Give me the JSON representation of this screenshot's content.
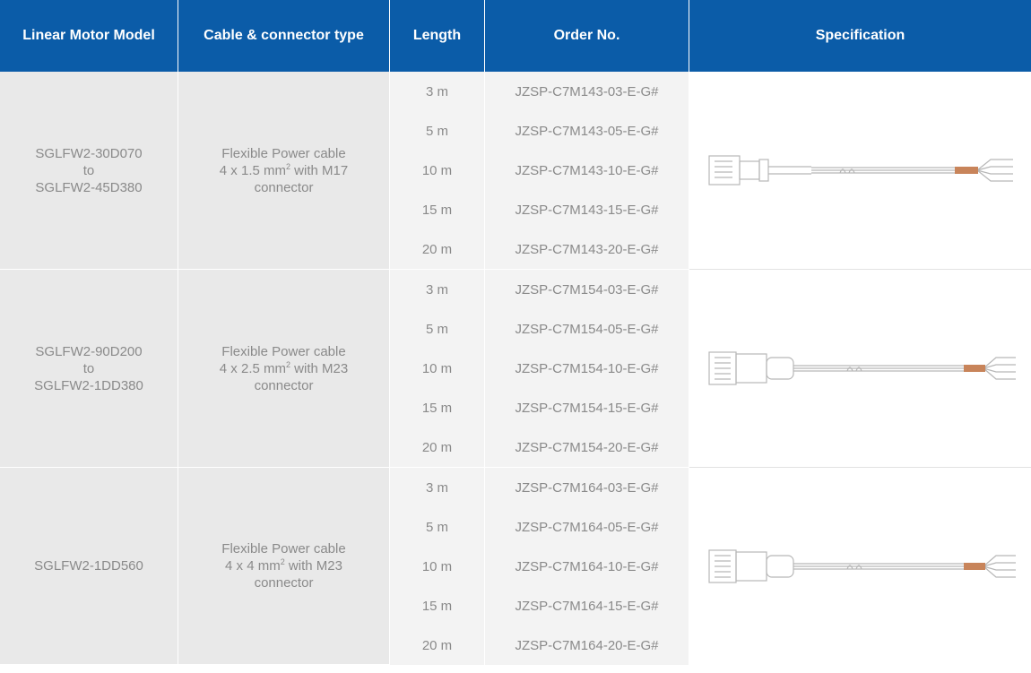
{
  "header": {
    "model": "Linear Motor Model",
    "cable_type": "Cable & connector type",
    "length": "Length",
    "order_no": "Order No.",
    "specification": "Specification"
  },
  "groups": [
    {
      "model_from": "SGLFW2-30D070",
      "model_to_word": "to",
      "model_to": "SGLFW2-45D380",
      "cable_line1": "Flexible Power cable",
      "cable_line2_prefix": "4 x 1.5 mm",
      "cable_line2_sup": "2",
      "cable_line2_suffix": " with M17",
      "cable_line3": "connector",
      "image_icon": "m17-cable-connector-image",
      "rows": [
        {
          "length": "3 m",
          "order": "JZSP-C7M143-03-E-G#"
        },
        {
          "length": "5 m",
          "order": "JZSP-C7M143-05-E-G#"
        },
        {
          "length": "10 m",
          "order": "JZSP-C7M143-10-E-G#"
        },
        {
          "length": "15 m",
          "order": "JZSP-C7M143-15-E-G#"
        },
        {
          "length": "20 m",
          "order": "JZSP-C7M143-20-E-G#"
        }
      ]
    },
    {
      "model_from": "SGLFW2-90D200",
      "model_to_word": "to",
      "model_to": "SGLFW2-1DD380",
      "cable_line1": "Flexible Power cable",
      "cable_line2_prefix": "4 x 2.5 mm",
      "cable_line2_sup": "2",
      "cable_line2_suffix": " with M23",
      "cable_line3": "connector",
      "image_icon": "m23-cable-connector-image",
      "rows": [
        {
          "length": "3 m",
          "order": "JZSP-C7M154-03-E-G#"
        },
        {
          "length": "5 m",
          "order": "JZSP-C7M154-05-E-G#"
        },
        {
          "length": "10 m",
          "order": "JZSP-C7M154-10-E-G#"
        },
        {
          "length": "15 m",
          "order": "JZSP-C7M154-15-E-G#"
        },
        {
          "length": "20 m",
          "order": "JZSP-C7M154-20-E-G#"
        }
      ]
    },
    {
      "model_from": "SGLFW2-1DD560",
      "cable_line1": "Flexible Power cable",
      "cable_line2_prefix": "4 x 4 mm",
      "cable_line2_sup": "2",
      "cable_line2_suffix": " with M23",
      "cable_line3": "connector",
      "image_icon": "m23-cable-connector-image",
      "rows": [
        {
          "length": "3 m",
          "order": "JZSP-C7M164-03-E-G#"
        },
        {
          "length": "5 m",
          "order": "JZSP-C7M164-05-E-G#"
        },
        {
          "length": "10 m",
          "order": "JZSP-C7M164-10-E-G#"
        },
        {
          "length": "15 m",
          "order": "JZSP-C7M164-15-E-G#"
        },
        {
          "length": "20 m",
          "order": "JZSP-C7M164-20-E-G#"
        }
      ]
    }
  ],
  "colors": {
    "header_bg": "#0b5ca8",
    "header_text": "#ffffff",
    "model_cell_bg": "#e9e9e9",
    "row_bg": "#f3f3f3",
    "body_text": "#8a8a8a",
    "cable_sleeve": "#c8845a"
  }
}
